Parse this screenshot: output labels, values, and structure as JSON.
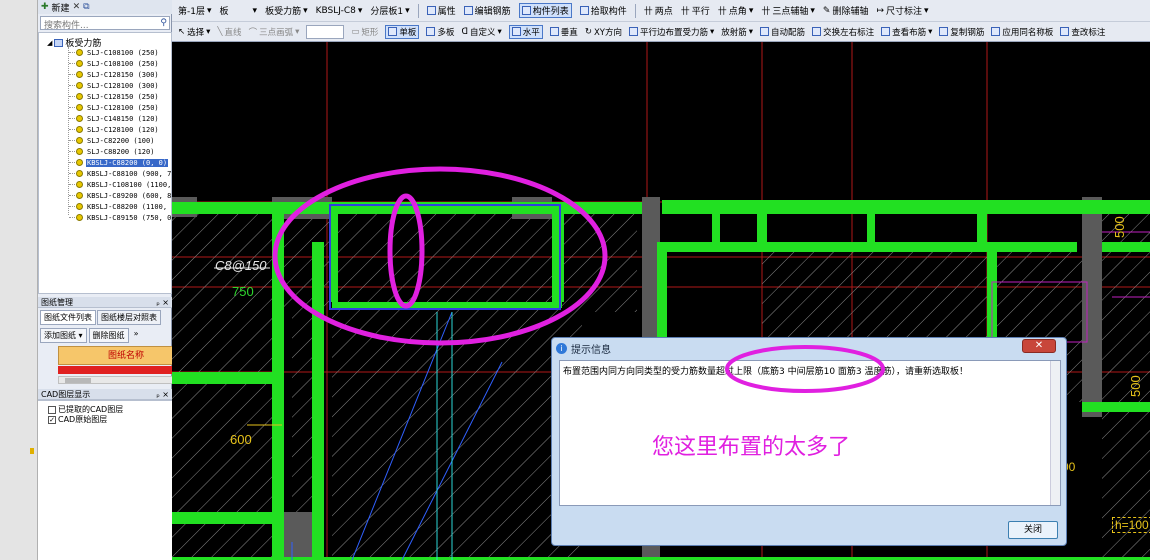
{
  "left_panel": {
    "toolbar": {
      "new_label": "新建",
      "delete_icon": "✕"
    },
    "search_placeholder": "搜索构件...",
    "tree": {
      "root_label": "板受力筋",
      "items": [
        "SLJ-C108100 (250)",
        "SLJ-C108100 (250)",
        "SLJ-C128150 (300)",
        "SLJ-C128100 (300)",
        "SLJ-C128150 (250)",
        "SLJ-C128100 (250)",
        "SLJ-C148150 (120)",
        "SLJ-C128100 (120)",
        "SLJ-C82200 (100)",
        "SLJ-C88200 (120)",
        "KBSLJ-C88200 (0, 0)",
        "KBSLJ-C88100 (900, 700)",
        "KBSLJ-C108100 (1100, 11",
        "KBSLJ-C89200 (600, 800)",
        "KBSLJ-C88200 (1100, 0)",
        "KBSLJ-C89150 (750, 0)"
      ],
      "selected_index": 10
    },
    "drawing_mgmt": {
      "title": "图纸管理",
      "pin": "ₚ ×",
      "tabs": [
        "图纸文件列表",
        "图纸楼层对照表"
      ],
      "buttons": [
        "添加图纸",
        "删除图纸"
      ],
      "more": "»",
      "name_header": "图纸名称"
    },
    "cad_layers": {
      "title": "CAD图层显示",
      "pin": "ₚ ×",
      "items": [
        {
          "label": "已提取的CAD图层",
          "checked": false
        },
        {
          "label": "CAD原始图层",
          "checked": true
        }
      ]
    }
  },
  "toolbar1": {
    "floor": "第-1层",
    "category": "板",
    "sub_category": "板受力筋",
    "component": "KBSLJ-C8",
    "layer": "分层板1",
    "items": [
      "属性",
      "编辑钢筋",
      "构件列表",
      "拾取构件",
      "两点",
      "平行",
      "点角",
      "三点辅轴",
      "删除辅轴",
      "尺寸标注"
    ],
    "active_item": "构件列表"
  },
  "toolbar2": {
    "items": [
      "选择",
      "直线",
      "三点画弧",
      "矩形",
      "单板",
      "多板",
      "自定义",
      "水平",
      "垂直",
      "XY方向",
      "平行边布置受力筋",
      "放射筋",
      "自动配筋",
      "交换左右标注",
      "查看布筋",
      "复制钢筋",
      "应用同名称板",
      "查改标注"
    ],
    "disabled": [
      "直线",
      "三点画弧",
      "矩形"
    ],
    "active": [
      "单板",
      "水平"
    ]
  },
  "canvas": {
    "labels": [
      {
        "text": "C8@150",
        "color": "#e6e6e6"
      },
      {
        "text": "750",
        "color": "#2ed62e"
      },
      {
        "text": "600",
        "color": "#e6c21a"
      },
      {
        "text": "500",
        "color": "#e6c21a"
      },
      {
        "text": "500",
        "color": "#e6c21a"
      },
      {
        "text": "00",
        "color": "#e6c21a"
      },
      {
        "text": "h=100",
        "color": "#e6c21a"
      }
    ]
  },
  "dialog": {
    "title": "提示信息",
    "message": "布置范围内同方向同类型的受力筋数量超过上限（底筋3  中间层筋10  面筋3  温度筋），请重新选取板！",
    "annotation": "您这里布置的太多了",
    "close_button": "关闭",
    "close_x": "✕"
  },
  "annotation_color": "#e020e0"
}
